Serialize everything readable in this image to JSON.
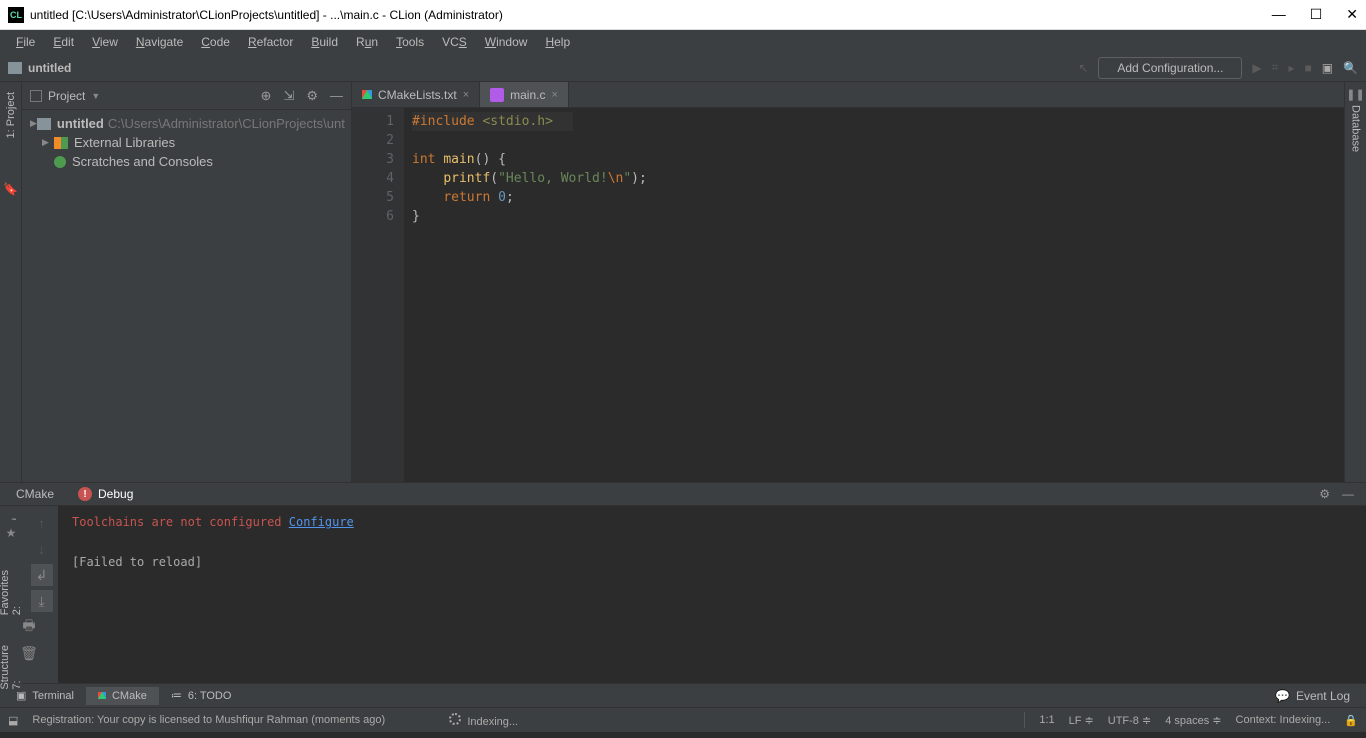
{
  "window": {
    "title": "untitled [C:\\Users\\Administrator\\CLionProjects\\untitled] - ...\\main.c - CLion (Administrator)",
    "app_badge": "CL"
  },
  "menu": [
    "File",
    "Edit",
    "View",
    "Navigate",
    "Code",
    "Refactor",
    "Build",
    "Run",
    "Tools",
    "VCS",
    "Window",
    "Help"
  ],
  "breadcrumb": "untitled",
  "config_button": "Add Configuration...",
  "project": {
    "title": "Project",
    "tree": {
      "root": "untitled",
      "root_path": "C:\\Users\\Administrator\\CLionProjects\\unt",
      "external": "External Libraries",
      "scratches": "Scratches and Consoles"
    }
  },
  "tabs": [
    {
      "name": "CMakeLists.txt",
      "active": false
    },
    {
      "name": "main.c",
      "active": true
    }
  ],
  "code": {
    "lines": [
      "1",
      "2",
      "3",
      "4",
      "5",
      "6"
    ],
    "include_kw": "#include",
    "include_hdr": "<stdio.h>",
    "int": "int",
    "main": "main",
    "printf": "printf",
    "hello": "\"Hello, World!",
    "esc": "\\n",
    "hello_end": "\"",
    "return": "return",
    "zero": "0"
  },
  "tool_tabs": {
    "cmake": "CMake",
    "debug": "Debug"
  },
  "tool_output": {
    "error": "Toolchains are not configured",
    "link": "Configure",
    "failed": "[Failed to reload]"
  },
  "bottom_tabs": {
    "terminal": "Terminal",
    "cmake": "CMake",
    "todo": "6: TODO",
    "eventlog": "Event Log"
  },
  "status": {
    "left": "Registration: Your copy is licensed to Mushfiqur Rahman (moments ago)",
    "indexing": "Indexing...",
    "pos": "1:1",
    "lf": "LF",
    "enc": "UTF-8",
    "spaces": "4 spaces",
    "context": "Context: Indexing..."
  },
  "side_tabs": {
    "project": "1: Project",
    "favorites": "2: Favorites",
    "structure": "7: Structure",
    "database": "Database"
  }
}
